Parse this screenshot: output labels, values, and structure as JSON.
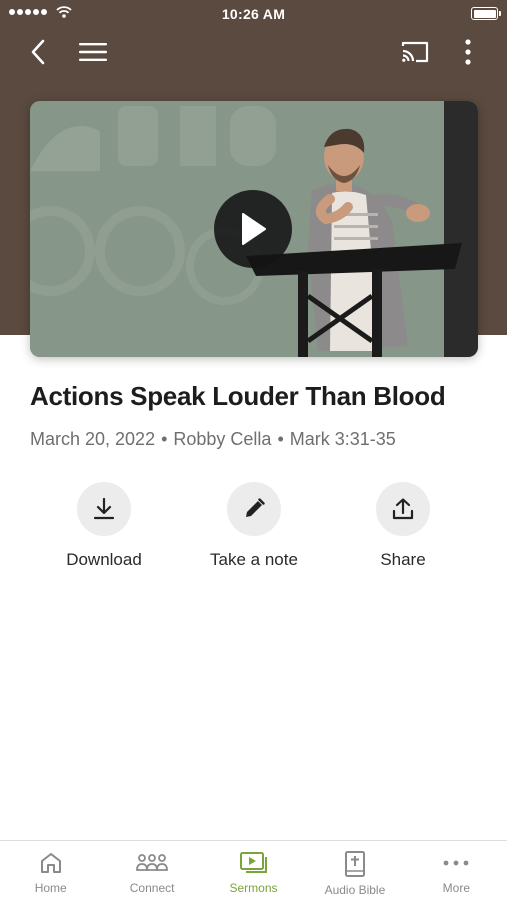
{
  "status_bar": {
    "time": "10:26 AM"
  },
  "header": {
    "background_color": "#5a4a3f",
    "back_icon": "chevron-left-icon",
    "menu_icon": "hamburger-menu-icon",
    "cast_icon": "cast-icon",
    "more_icon": "vertical-dots-icon"
  },
  "media": {
    "play_icon": "play-icon"
  },
  "sermon": {
    "title": "Actions Speak Louder Than Blood",
    "date": "March 20, 2022",
    "speaker": "Robby Cella",
    "scripture": "Mark 3:31-35",
    "separator": "•"
  },
  "actions": [
    {
      "label": "Download",
      "icon": "download-icon"
    },
    {
      "label": "Take a note",
      "icon": "pencil-icon"
    },
    {
      "label": "Share",
      "icon": "share-icon"
    }
  ],
  "tabbar": {
    "active_color": "#7aa53c",
    "tabs": [
      {
        "label": "Home",
        "icon": "home-icon",
        "active": false
      },
      {
        "label": "Connect",
        "icon": "people-icon",
        "active": false
      },
      {
        "label": "Sermons",
        "icon": "video-playlist-icon",
        "active": true
      },
      {
        "label": "Audio Bible",
        "icon": "bible-icon",
        "active": false
      },
      {
        "label": "More",
        "icon": "horizontal-dots-icon",
        "active": false
      }
    ]
  }
}
